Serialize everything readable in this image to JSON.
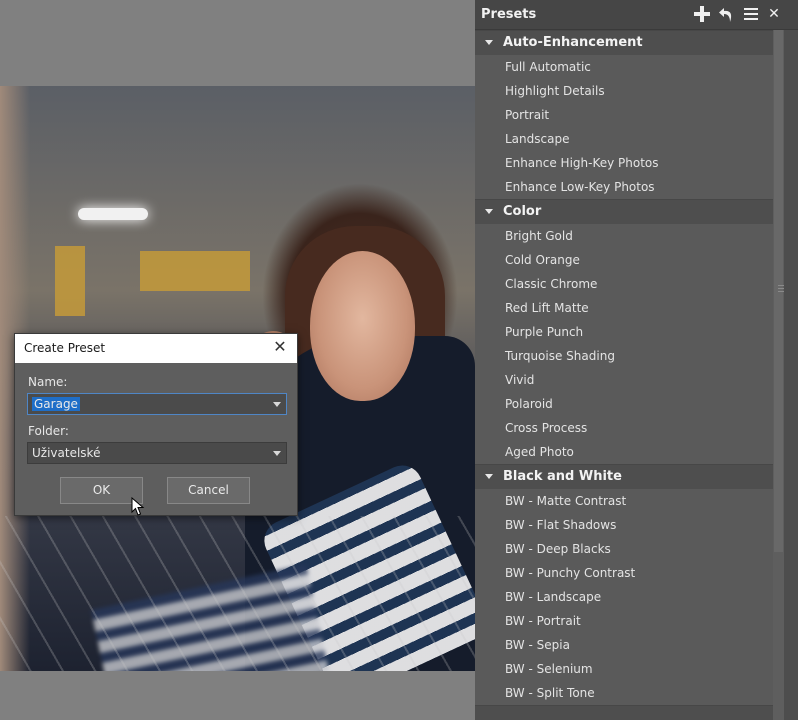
{
  "presets_panel": {
    "title": "Presets",
    "header_icons": [
      "plus-icon",
      "undo-icon",
      "menu-icon",
      "close-icon"
    ],
    "categories": [
      {
        "name": "Auto-Enhancement",
        "items": [
          "Full Automatic",
          "Highlight Details",
          "Portrait",
          "Landscape",
          "Enhance High-Key Photos",
          "Enhance Low-Key Photos"
        ]
      },
      {
        "name": "Color",
        "items": [
          "Bright Gold",
          "Cold Orange",
          "Classic Chrome",
          "Red Lift Matte",
          "Purple Punch",
          "Turquoise Shading",
          "Vivid",
          "Polaroid",
          "Cross Process",
          "Aged Photo"
        ]
      },
      {
        "name": "Black and White",
        "items": [
          "BW - Matte Contrast",
          "BW - Flat Shadows",
          "BW - Deep Blacks",
          "BW - Punchy Contrast",
          "BW - Landscape",
          "BW - Portrait",
          "BW - Sepia",
          "BW - Selenium",
          "BW - Split Tone"
        ]
      }
    ]
  },
  "dialog": {
    "title": "Create Preset",
    "name_label": "Name:",
    "name_value": "Garage",
    "folder_label": "Folder:",
    "folder_value": "Uživatelské",
    "ok_label": "OK",
    "cancel_label": "Cancel"
  },
  "colors": {
    "panel_bg": "#5a5a5a",
    "header_bg": "#464646",
    "selection": "#1e6ec8",
    "canvas_bg": "#808080"
  }
}
